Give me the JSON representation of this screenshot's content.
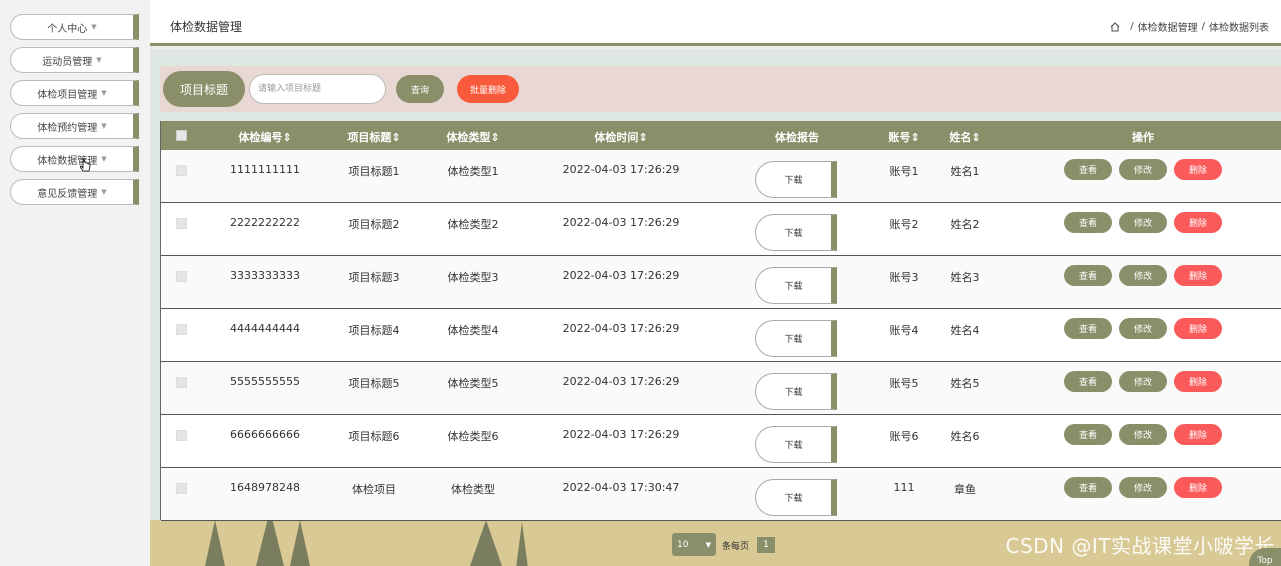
{
  "sidebar": {
    "items": [
      {
        "label": "个人中心"
      },
      {
        "label": "运动员管理"
      },
      {
        "label": "体检项目管理"
      },
      {
        "label": "体检预约管理"
      },
      {
        "label": "体检数据管理"
      },
      {
        "label": "意见反馈管理"
      }
    ]
  },
  "header": {
    "title": "体检数据管理",
    "breadcrumb": [
      "体检数据管理",
      "体检数据列表"
    ]
  },
  "search": {
    "label": "项目标题",
    "placeholder": "请输入项目标题",
    "query_label": "查询",
    "batch_delete_label": "批量删除"
  },
  "table": {
    "columns": [
      "体检编号",
      "项目标题",
      "体检类型",
      "体检时间",
      "体检报告",
      "账号",
      "姓名",
      "操作"
    ],
    "rows": [
      {
        "id": "1111111111",
        "title": "项目标题1",
        "type": "体检类型1",
        "time": "2022-04-03 17:26:29",
        "account": "账号1",
        "name": "姓名1"
      },
      {
        "id": "2222222222",
        "title": "项目标题2",
        "type": "体检类型2",
        "time": "2022-04-03 17:26:29",
        "account": "账号2",
        "name": "姓名2"
      },
      {
        "id": "3333333333",
        "title": "项目标题3",
        "type": "体检类型3",
        "time": "2022-04-03 17:26:29",
        "account": "账号3",
        "name": "姓名3"
      },
      {
        "id": "4444444444",
        "title": "项目标题4",
        "type": "体检类型4",
        "time": "2022-04-03 17:26:29",
        "account": "账号4",
        "name": "姓名4"
      },
      {
        "id": "5555555555",
        "title": "项目标题5",
        "type": "体检类型5",
        "time": "2022-04-03 17:26:29",
        "account": "账号5",
        "name": "姓名5"
      },
      {
        "id": "6666666666",
        "title": "项目标题6",
        "type": "体检类型6",
        "time": "2022-04-03 17:26:29",
        "account": "账号6",
        "name": "姓名6"
      },
      {
        "id": "1648978248",
        "title": "体检项目",
        "type": "体检类型",
        "time": "2022-04-03 17:30:47",
        "account": "111",
        "name": "章鱼"
      }
    ],
    "download_label": "下载",
    "view_label": "查看",
    "edit_label": "修改",
    "delete_label": "删除"
  },
  "pagination": {
    "page_size": "10",
    "per_page_label": "条每页",
    "current_page": "1"
  },
  "watermark": "CSDN @IT实战课堂小啵学长",
  "top_label": "Top",
  "colors": {
    "accent": "#8b8f69",
    "danger": "#fa5a5a",
    "search_bg": "#e8d7d3"
  }
}
